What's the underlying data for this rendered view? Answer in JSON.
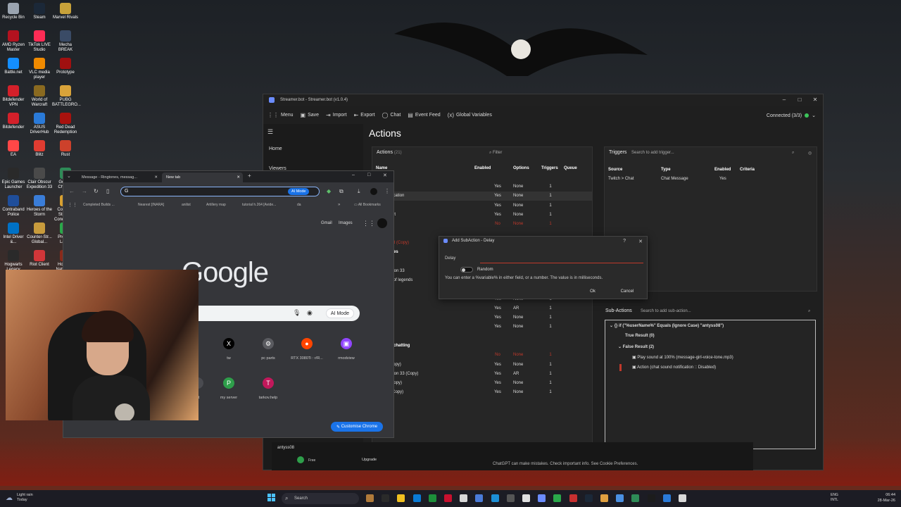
{
  "desktop": {
    "icons": [
      {
        "label": "Recycle Bin",
        "color": "#9aa4b0"
      },
      {
        "label": "Steam",
        "color": "#1b2838"
      },
      {
        "label": "Marvel Rivals",
        "color": "#c8a23a"
      },
      {
        "label": "AMD Ryzen Master",
        "color": "#b3121f"
      },
      {
        "label": "TikTok LIVE Studio",
        "color": "#fe2c55"
      },
      {
        "label": "Mecha BREAK",
        "color": "#3a4b66"
      },
      {
        "label": "Battle.net",
        "color": "#148eff"
      },
      {
        "label": "VLC media player",
        "color": "#f08a00"
      },
      {
        "label": "Prototype",
        "color": "#a01010"
      },
      {
        "label": "Bitdefender VPN",
        "color": "#d3202a"
      },
      {
        "label": "World of Warcraft",
        "color": "#8a6a20"
      },
      {
        "label": "PUBG BATTLEGRO...",
        "color": "#d9a33a"
      },
      {
        "label": "Bitdefender",
        "color": "#d3202a"
      },
      {
        "label": "ASUS DriverHub",
        "color": "#2a7ad8"
      },
      {
        "label": "Red Dead Redemption",
        "color": "#a8120e"
      },
      {
        "label": "EA",
        "color": "#ff4747"
      },
      {
        "label": "Blitz",
        "color": "#e03c31"
      },
      {
        "label": "Rust",
        "color": "#cd412b"
      },
      {
        "label": "Epic Games Launcher",
        "color": "#2a2a2a"
      },
      {
        "label": "Clair Obscur Expedition 33",
        "color": "#4a4a4a"
      },
      {
        "label": "Google Chrome",
        "color": "#2e8b57"
      },
      {
        "label": "Contraband Police",
        "color": "#1f4e9a"
      },
      {
        "label": "Heroes of the Storm",
        "color": "#3a7dd8"
      },
      {
        "label": "Counter-Strike 2 Condition ...",
        "color": "#d8a030"
      },
      {
        "label": "Intel Driver &...",
        "color": "#0071c5"
      },
      {
        "label": "Counter-Str... Global...",
        "color": "#c89b3c"
      },
      {
        "label": "Process Lasso",
        "color": "#2aa84a"
      },
      {
        "label": "Hogwarts Legacy",
        "color": "#2a2a2a"
      },
      {
        "label": "Riot Client",
        "color": "#d13639"
      },
      {
        "label": "Holdfast Nations ...",
        "color": "#8a2a1a"
      }
    ]
  },
  "streamerbot": {
    "title": "Streamer.bot - Streamer.bot (v1.0.4)",
    "toolbar": [
      "Menu",
      "Save",
      "Import",
      "Export",
      "Chat",
      "Event Feed",
      "Global Variables"
    ],
    "connected": "Connected (3/3)",
    "nav": [
      "Home",
      "Viewers"
    ],
    "heading": "Actions",
    "actions": {
      "title": "Actions",
      "count": "(21)",
      "filter_placeholder": "Filter",
      "columns": [
        "Name",
        "Enabled",
        "Options",
        "Triggers",
        "Queue"
      ],
      "rows": [
        {
          "name": "",
          "enabled": "",
          "options": "",
          "triggers": "",
          "group": true
        },
        {
          "name": "n",
          "enabled": "Yes",
          "options": "None",
          "triggers": "1"
        },
        {
          "name": "und notification",
          "enabled": "Yes",
          "options": "None",
          "triggers": "1"
        },
        {
          "name": "tting",
          "enabled": "Yes",
          "options": "None",
          "triggers": "1"
        },
        {
          "name": "ower altert",
          "enabled": "Yes",
          "options": "None",
          "triggers": "1"
        },
        {
          "name": "etector",
          "enabled": "No",
          "options": "None",
          "triggers": "1",
          "disabled": true
        },
        {
          "name": "lay sound",
          "enabled": "",
          "options": "",
          "triggers": ""
        },
        {
          "name": "hat Sound (Copy)",
          "enabled": "",
          "options": "",
          "triggers": "",
          "disabled": true
        },
        {
          "name": "g to games",
          "enabled": "",
          "options": "",
          "triggers": "",
          "group": true
        },
        {
          "name": "o EFT",
          "enabled": "",
          "options": "",
          "triggers": ""
        },
        {
          "name": "o expedition 33",
          "enabled": "",
          "options": "",
          "triggers": ""
        },
        {
          "name": "o league of legends",
          "enabled": "Yes",
          "options": "AR",
          "triggers": "1"
        },
        {
          "name": "o Rust",
          "enabled": "Yes",
          "options": "None",
          "triggers": "1"
        },
        {
          "name": "o",
          "enabled": "Yes",
          "options": "None",
          "triggers": "1"
        },
        {
          "name": "or HILL",
          "enabled": "Yes",
          "options": "AR",
          "triggers": "1"
        },
        {
          "name": "or Squad",
          "enabled": "Yes",
          "options": "None",
          "triggers": "1"
        },
        {
          "name": "ommand",
          "enabled": "Yes",
          "options": "None",
          "triggers": "1"
        },
        {
          "name": "",
          "enabled": "",
          "options": "",
          "triggers": ""
        },
        {
          "name": "g to just chatting",
          "enabled": "",
          "options": "",
          "triggers": "",
          "group": true
        },
        {
          "name": "om LoL",
          "enabled": "No",
          "options": "None",
          "triggers": "1",
          "disabled": true
        },
        {
          "name": "o EFT (Copy)",
          "enabled": "Yes",
          "options": "None",
          "triggers": "1"
        },
        {
          "name": "o expedition 33 (Copy)",
          "enabled": "Yes",
          "options": "AR",
          "triggers": "1"
        },
        {
          "name": "o Rust (Copy)",
          "enabled": "Yes",
          "options": "None",
          "triggers": "1"
        },
        {
          "name": "or HILL (Copy)",
          "enabled": "Yes",
          "options": "None",
          "triggers": "1"
        }
      ]
    },
    "triggers": {
      "title": "Triggers",
      "search_placeholder": "Search to add trigger...",
      "columns": [
        "Source",
        "Type",
        "Enabled",
        "Criteria"
      ],
      "rows": [
        {
          "source": "Twitch > Chat",
          "type": "Chat Message",
          "enabled": "Yes",
          "criteria": ""
        }
      ]
    },
    "subactions": {
      "title": "Sub-Actions",
      "search_placeholder": "Search to add sub-action...",
      "items": [
        "if (\"%userName%\" Equals (Ignore Case) \"antyss08\")",
        "True Result (0)",
        "False Result (2)",
        "Play sound at 100% (message-girl-voice-tone.mp3)",
        "Action (chat sound notification :: Disabled)"
      ]
    }
  },
  "dialog": {
    "title": "Add SubAction - Delay",
    "delay_label": "Delay",
    "random_label": "Random",
    "help": "You can enter a %variable% in either field, or a number. The value is in milliseconds.",
    "ok": "Ok",
    "cancel": "Cancel"
  },
  "chrome": {
    "tabs": [
      "Message - Ringtones, messag...",
      "New tab"
    ],
    "ai_mode": "AI Mode",
    "bookmarks": [
      "Completed Builds ...",
      "Nearest [INARA]",
      "anilist",
      "Artillery map",
      "tutorial h.264 [Avide...",
      "da"
    ],
    "all_bookmarks": "All Bookmarks",
    "top_links": [
      "Gmail",
      "Images"
    ],
    "logo": "Google",
    "shortcuts": [
      {
        "label": "tw",
        "glyph": "X",
        "color": "#000000"
      },
      {
        "label": "pc parts",
        "glyph": "⚙",
        "color": "#5a5b60"
      },
      {
        "label": "RTX 3080Ti : r/R...",
        "glyph": "●",
        "color": "#ff4500"
      },
      {
        "label": "rmodview",
        "glyph": "▣",
        "color": "#9146ff"
      },
      {
        "label": "nt",
        "glyph": "",
        "color": "#4a4b50"
      },
      {
        "label": "my server",
        "glyph": "P",
        "color": "#2e9e4a"
      },
      {
        "label": "tarkov.help",
        "glyph": "T",
        "color": "#c2185b"
      }
    ],
    "customise": "Customise Chrome"
  },
  "chatgpt": {
    "user": "antyss08",
    "free": "Free",
    "upgrade": "Upgrade",
    "warning": "ChatGPT can make mistakes. Check important info. See Cookie Preferences."
  },
  "taskbar": {
    "weather": "Light rain",
    "weather_sub": "Today",
    "search": "Search",
    "lang": "ENG",
    "lang_sub": "INTL",
    "time": "06:44",
    "date": "28-Mar-26"
  }
}
